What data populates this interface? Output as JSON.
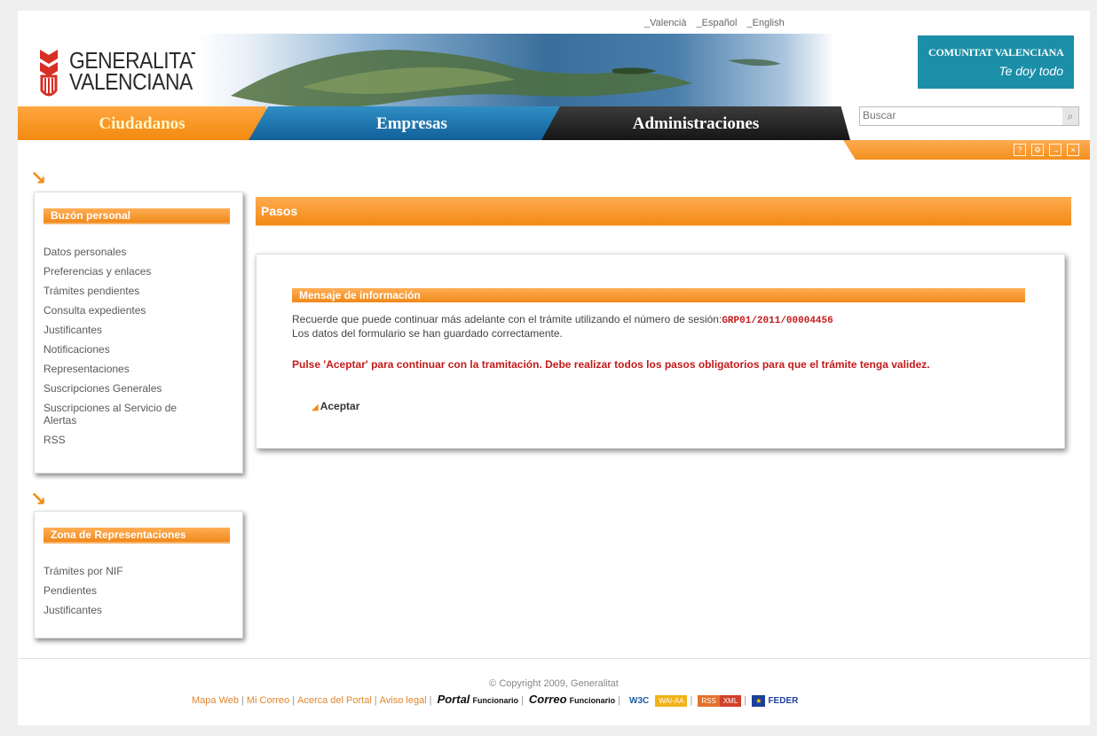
{
  "lang": {
    "valencia": "_Valencià",
    "espanol": "_Español",
    "english": "_English"
  },
  "logo": {
    "line1": "GENERALITAT",
    "line2": "VALENCIANA"
  },
  "brand": {
    "line1": "COMUNITAT VALENCIANA",
    "line2": "Te doy todo"
  },
  "tabs": {
    "ciudadanos": "Ciudadanos",
    "empresas": "Empresas",
    "administraciones": "Administraciones"
  },
  "search": {
    "placeholder": "Buscar"
  },
  "toolbar": {
    "icons": [
      "help-icon",
      "settings-icon",
      "login-icon",
      "close-icon"
    ]
  },
  "sidebar": {
    "buzon": {
      "title": "Buzón personal",
      "items": [
        "Datos personales",
        "Preferencias y enlaces",
        "Trámites pendientes",
        "Consulta expedientes",
        "Justificantes",
        "Notificaciones",
        "Representaciones",
        "Suscripciones Generales",
        "Suscripciones al Servicio de Alertas",
        "RSS"
      ]
    },
    "zona": {
      "title": "Zona de Representaciones",
      "items": [
        "Trámites por NIF",
        "Pendientes",
        "Justificantes"
      ]
    }
  },
  "main": {
    "title": "Pasos",
    "msg_header": "Mensaje de información",
    "line1": "Recuerde que puede continuar más adelante con el trámite utilizando el número de sesión:",
    "session": "GRP01/2011/00004456",
    "line2": "Los datos del formulario se han guardado correctamente.",
    "warning": "Pulse 'Aceptar' para continuar con la tramitación. Debe realizar todos los pasos obligatorios para que el trámite tenga validez.",
    "accept": "Aceptar"
  },
  "footer": {
    "copyright": "© Copyright 2009, Generalitat",
    "links": [
      "Mapa Web",
      "Mi Correo",
      "Acerca del Portal",
      "Aviso legal"
    ],
    "portal": "Portal",
    "portal_sub": "Funcionario",
    "correo": "Correo",
    "correo_sub": "Funcionario",
    "w3c": "W3C",
    "wai": "WAI-AA",
    "rss": "RSS",
    "xml": "XML",
    "feder": "FEDER"
  },
  "colors": {
    "orange": "#f28b16",
    "blue": "#12609a",
    "dark": "#1a1a1a",
    "red": "#c41a1a",
    "teal": "#1c8fa8"
  }
}
